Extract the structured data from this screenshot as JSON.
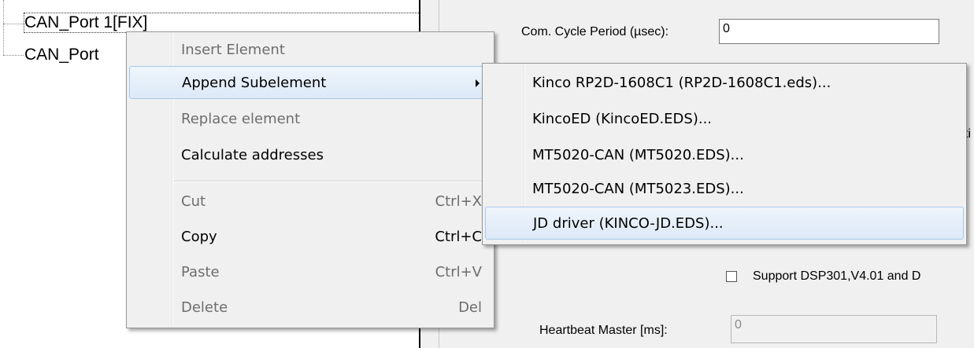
{
  "tree": {
    "items": [
      {
        "label": "CAN_Port 1[FIX]"
      },
      {
        "label": "CAN_Port"
      }
    ]
  },
  "panel": {
    "cycle_label": "Com. Cycle Period (µsec):",
    "cycle_value": "0",
    "partial_label": "ti",
    "dsp_label": "Support DSP301,V4.01 and D",
    "heartbeat_label": "Heartbeat Master [ms]:",
    "heartbeat_value": "0"
  },
  "context_menu": {
    "items": [
      {
        "label": "Insert Element",
        "shortcut": "",
        "enabled": false
      },
      {
        "label": "Append Subelement",
        "shortcut": "",
        "enabled": true,
        "submenu": true
      },
      {
        "label": "Replace element",
        "shortcut": "",
        "enabled": false
      },
      {
        "label": "Calculate addresses",
        "shortcut": "",
        "enabled": true
      },
      {
        "label": "Cut",
        "shortcut": "Ctrl+X",
        "enabled": false
      },
      {
        "label": "Copy",
        "shortcut": "Ctrl+C",
        "enabled": true
      },
      {
        "label": "Paste",
        "shortcut": "Ctrl+V",
        "enabled": false
      },
      {
        "label": "Delete",
        "shortcut": "Del",
        "enabled": false
      }
    ]
  },
  "submenu": {
    "items": [
      {
        "label": "Kinco RP2D-1608C1 (RP2D-1608C1.eds)..."
      },
      {
        "label": "KincoED (KincoED.EDS)..."
      },
      {
        "label": "MT5020-CAN (MT5020.EDS)..."
      },
      {
        "label": "MT5020-CAN (MT5023.EDS)..."
      },
      {
        "label": "JD driver (KINCO-JD.EDS)..."
      }
    ],
    "highlighted_index": 4
  },
  "colors": {
    "highlight_border": "#a8c8eb",
    "highlight_fill": "#dde9f7",
    "menu_bg": "#f0f0f0",
    "disabled_text": "#6d6d6d"
  },
  "icons": [
    "submenu-arrow-icon",
    "checkbox-unchecked-icon"
  ]
}
